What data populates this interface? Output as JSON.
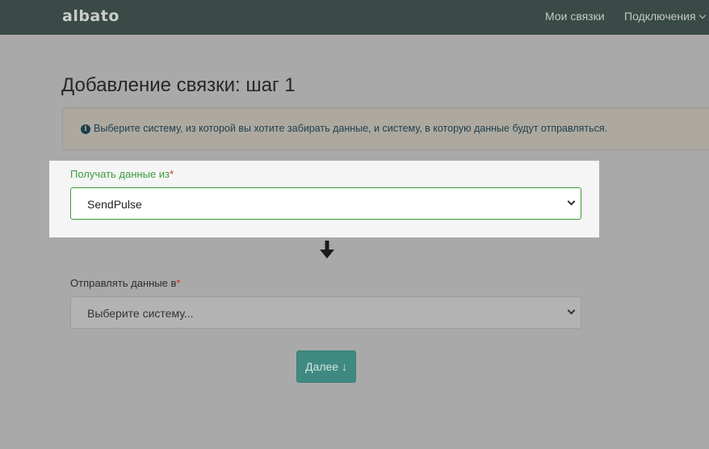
{
  "navbar": {
    "logo": "albato",
    "links": [
      {
        "label": "Мои связки"
      },
      {
        "label": "Подключения"
      }
    ]
  },
  "page": {
    "title": "Добавление связки: шаг 1"
  },
  "info": {
    "icon": "info-circle-icon",
    "text": "Выберите систему, из которой вы хотите забирать данные, и систему, в которую данные будут отправляться."
  },
  "form": {
    "source": {
      "label": "Получать данные из",
      "required_mark": "*",
      "value": "SendPulse"
    },
    "target": {
      "label": "Отправлять данные в",
      "required_mark": "*",
      "value": "Выберите систему..."
    },
    "next_button": "Далее ↓"
  },
  "colors": {
    "navbar": "#3a4a46",
    "accent_green": "#3c9a3c",
    "button": "#3f8a80"
  }
}
